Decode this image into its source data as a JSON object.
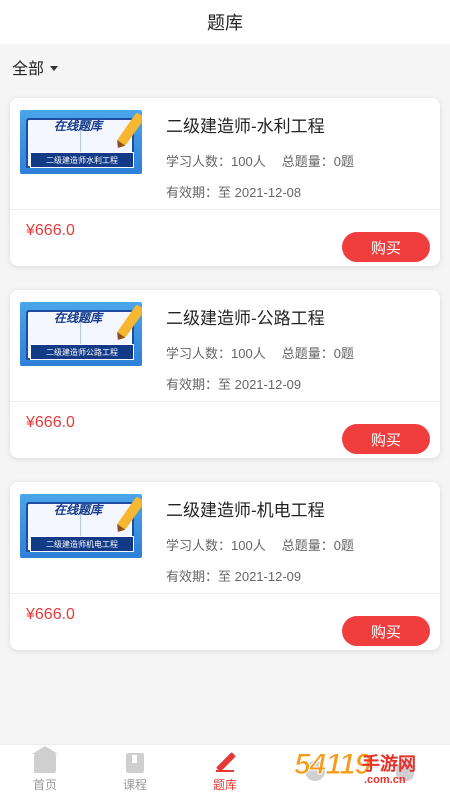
{
  "header": {
    "title": "题库"
  },
  "filter": {
    "label": "全部"
  },
  "courses": [
    {
      "cover_big": "在线题库",
      "cover_banner": "二级建造师水利工程",
      "name": "二级建造师-水利工程",
      "students": "学习人数：100人",
      "questions": "总题量：0题",
      "expiry": "有效期：至 2021-12-08",
      "price": "¥666.0",
      "buy_label": "购买"
    },
    {
      "cover_big": "在线题库",
      "cover_banner": "二级建造师公路工程",
      "name": "二级建造师-公路工程",
      "students": "学习人数：100人",
      "questions": "总题量：0题",
      "expiry": "有效期：至 2021-12-09",
      "price": "¥666.0",
      "buy_label": "购买"
    },
    {
      "cover_big": "在线题库",
      "cover_banner": "二级建造师机电工程",
      "name": "二级建造师-机电工程",
      "students": "学习人数：100人",
      "questions": "总题量：0题",
      "expiry": "有效期：至 2021-12-09",
      "price": "¥666.0",
      "buy_label": "购买"
    }
  ],
  "tabbar": {
    "items": [
      {
        "label": "首页",
        "icon": "home-icon"
      },
      {
        "label": "课程",
        "icon": "course-icon"
      },
      {
        "label": "题库",
        "icon": "question-bank-icon",
        "active": true
      }
    ]
  },
  "watermark": {
    "num": "54119",
    "cn": "手游网",
    "url": ".com.cn"
  },
  "colors": {
    "accent": "#f03e3e",
    "price": "#e23a3a",
    "background": "#f5f5f5"
  }
}
